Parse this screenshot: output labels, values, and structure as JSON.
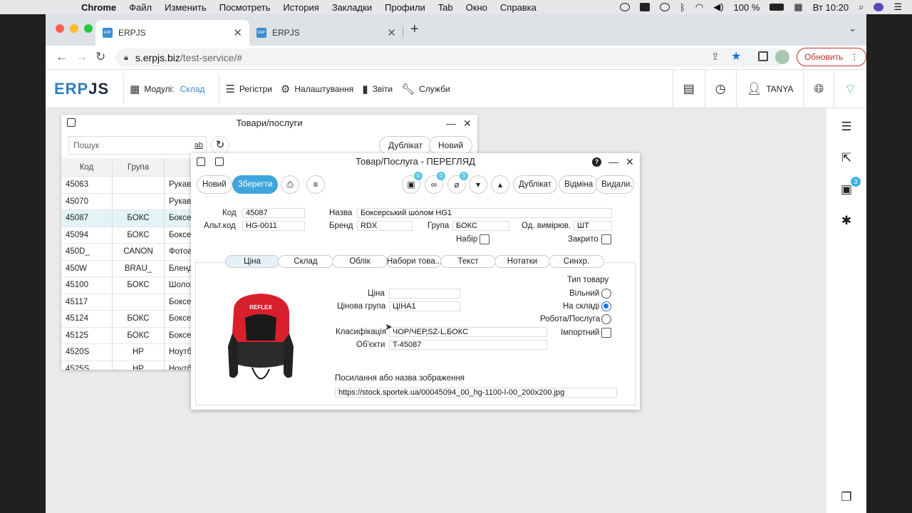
{
  "menubar": {
    "app": "Chrome",
    "items": [
      "Файл",
      "Изменить",
      "Посмотреть",
      "История",
      "Закладки",
      "Профили",
      "Tab",
      "Окно",
      "Справка"
    ],
    "battery": "100 %",
    "clock": "Вт 10:20"
  },
  "browser": {
    "tabs": [
      {
        "label": "ERPJS"
      },
      {
        "label": "ERPJS"
      }
    ],
    "url_host": "s.erpjs.biz",
    "url_path": "/test-service/#",
    "update_label": "Обновить"
  },
  "header": {
    "logo_a": "ERP",
    "logo_b": "JS",
    "modules_label": "Модулі:",
    "modules_value": "Склад",
    "registers": "Регістри",
    "settings": "Налаштування",
    "reports": "Звіти",
    "services": "Служби",
    "user": "TANYA"
  },
  "rail": {
    "badge": "3"
  },
  "list_window": {
    "title": "Товари/послуги",
    "search_placeholder": "Пошук",
    "search_ab": "ab",
    "duplicate": "Дублікат",
    "new": "Новий",
    "columns": {
      "code": "Код",
      "group": "Група"
    },
    "rows": [
      {
        "code": "45063",
        "group": "",
        "name": "Рукав"
      },
      {
        "code": "45070",
        "group": "",
        "name": "Рукав"
      },
      {
        "code": "45087",
        "group": "БОКС",
        "name": "Боксе"
      },
      {
        "code": "45094",
        "group": "БОКС",
        "name": "Боксе"
      },
      {
        "code": "450D_",
        "group": "CANON",
        "name": "Фотоа"
      },
      {
        "code": "450W",
        "group": "BRAU_",
        "name": "Бленд"
      },
      {
        "code": "45100",
        "group": "БОКС",
        "name": "Шолог"
      },
      {
        "code": "45117",
        "group": "",
        "name": "Боксе"
      },
      {
        "code": "45124",
        "group": "БОКС",
        "name": "Боксе"
      },
      {
        "code": "45125",
        "group": "БОКС",
        "name": "Боксе"
      },
      {
        "code": "4520S",
        "group": "HP",
        "name": "Ноутб"
      },
      {
        "code": "4525S",
        "group": "HP",
        "name": "Ноутб"
      }
    ]
  },
  "detail": {
    "title": "Товар/Послуга - ПЕРЕГЛЯД",
    "toolbar": {
      "new": "Новий",
      "save": "Зберегти",
      "duplicate": "Дублікат",
      "cancel": "Відміна",
      "delete": "Видали...",
      "badge_a": "0",
      "badge_b": "0",
      "badge_c": "0"
    },
    "labels": {
      "code": "Код",
      "alt_code": "Альт.код",
      "name": "Назва",
      "brand": "Бренд",
      "group": "Група",
      "unit": "Од. вимірюв.",
      "set": "Набір",
      "closed": "Закрито"
    },
    "values": {
      "code": "45087",
      "alt_code": "HG-0011",
      "name": "Боксерський шолом HG1",
      "brand": "RDX",
      "group": "БОКС",
      "unit": "ШТ"
    },
    "tabs": [
      "Ціна",
      "Склад",
      "Облік",
      "Набори това...",
      "Текст",
      "Нотатки",
      "Синхр."
    ],
    "price_tab": {
      "price_label": "Ціна",
      "price_value": "",
      "price_group_label": "Цінова група",
      "price_group_value": "ЦІНА1",
      "classification_label": "Класифікація",
      "classification_value": "ЧОР/ЧЕР,SZ-L,БОКС",
      "objects_label": "Об'єкти",
      "objects_value": "T-45087",
      "image_label": "Посилання або назва зображення",
      "image_value": "https://stock.sportek.ua/00045094_00_hg-1100-l-00_200x200.jpg",
      "product_type_label": "Тип товару",
      "free": "Вільний",
      "in_stock": "На складі",
      "work_service": "Робота/Послуга",
      "import": "Імпортний",
      "helmet_brand": "REFLEX"
    }
  },
  "colors": {
    "accent": "#3ea6dd",
    "wifi": "#20b860",
    "logo_blue": "#2e7dbd"
  }
}
